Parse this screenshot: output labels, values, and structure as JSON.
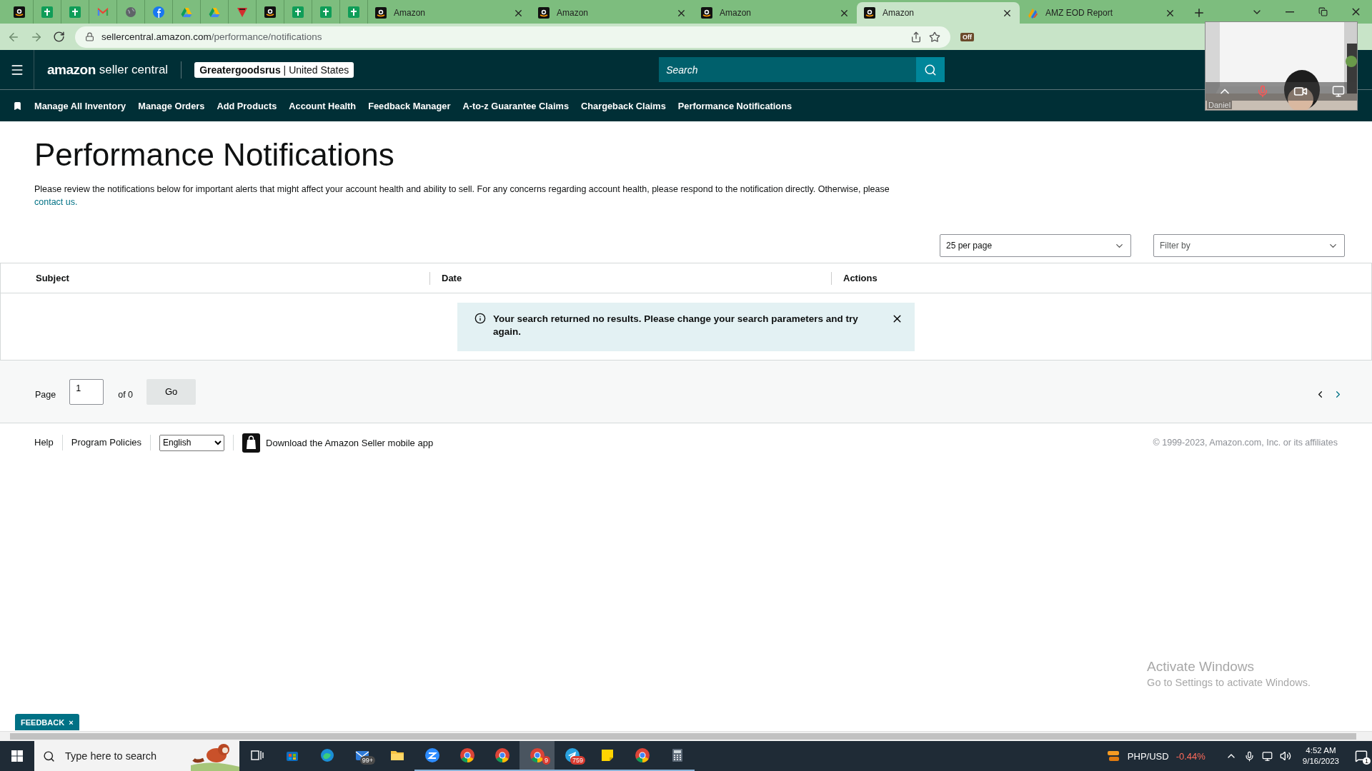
{
  "browser": {
    "tabs": [
      {
        "kind": "amazon",
        "selected": false
      },
      {
        "kind": "sheets",
        "selected": false
      },
      {
        "kind": "sheets",
        "selected": false
      },
      {
        "kind": "gmail",
        "selected": false
      },
      {
        "kind": "globe",
        "selected": false
      },
      {
        "kind": "facebook",
        "selected": false
      },
      {
        "kind": "drive",
        "selected": false
      },
      {
        "kind": "drive",
        "selected": false
      },
      {
        "kind": "triangle",
        "selected": false
      },
      {
        "kind": "amazon",
        "selected": false
      },
      {
        "kind": "sheets",
        "selected": false
      },
      {
        "kind": "sheets",
        "selected": false
      },
      {
        "kind": "sheets",
        "selected": false
      },
      {
        "kind": "amazon",
        "title": "Amazon",
        "selected": false
      },
      {
        "kind": "amazon",
        "title": "Amazon",
        "selected": false
      },
      {
        "kind": "amazon",
        "title": "Amazon",
        "selected": false
      },
      {
        "kind": "amazon",
        "title": "Amazon",
        "selected": true
      },
      {
        "kind": "report",
        "title": "AMZ EOD Report",
        "selected": false
      }
    ],
    "url": {
      "domain": "sellercentral.amazon.com",
      "path": "/performance/notifications"
    },
    "extension_badge": "Off"
  },
  "video_call": {
    "name": "Daniel"
  },
  "header": {
    "logo": {
      "brand": "amazon",
      "product": "seller central"
    },
    "store": {
      "name": "Greatergoodsrus",
      "region": "| United States"
    },
    "search": {
      "placeholder": "Search"
    }
  },
  "nav": {
    "items": [
      "Manage All Inventory",
      "Manage Orders",
      "Add Products",
      "Account Health",
      "Feedback Manager",
      "A-to-z Guarantee Claims",
      "Chargeback Claims",
      "Performance Notifications"
    ]
  },
  "page": {
    "title": "Performance Notifications",
    "description": "Please review the notifications below for important alerts that might affect your account health and ability to sell. For any concerns regarding account health, please respond to the notification directly. Otherwise, please",
    "link": "contact us.",
    "per_page": "25 per page",
    "filter": "Filter by"
  },
  "table": {
    "columns": [
      "Subject",
      "Date",
      "Actions"
    ],
    "alert": "Your search returned no results. Please change your search parameters and try again."
  },
  "pagination": {
    "label": "Page",
    "value": "1",
    "total": "of 0",
    "button": "Go"
  },
  "footer": {
    "links": [
      "Help",
      "Program Policies"
    ],
    "language": "English",
    "app": "Download the Amazon Seller mobile app",
    "copyright": "© 1999-2023, Amazon.com, Inc. or its affiliates"
  },
  "feedback": {
    "label": "FEEDBACK",
    "close": "×"
  },
  "activation": {
    "title": "Activate Windows",
    "subtitle": "Go to Settings to activate Windows."
  },
  "taskbar": {
    "search_placeholder": "Type here to search",
    "apps": [
      {
        "kind": "taskview",
        "running": false,
        "selected": false
      },
      {
        "kind": "store",
        "running": false,
        "selected": false
      },
      {
        "kind": "edge",
        "running": false,
        "selected": false
      },
      {
        "kind": "mail",
        "badge": "99+",
        "running": false,
        "selected": false
      },
      {
        "kind": "folder",
        "running": false,
        "selected": false
      },
      {
        "kind": "zoom",
        "running": true,
        "selected": false
      },
      {
        "kind": "chrome",
        "running": true,
        "selected": false
      },
      {
        "kind": "chrome",
        "running": true,
        "selected": false
      },
      {
        "kind": "chrome",
        "badge": "9",
        "running": true,
        "selected": true
      },
      {
        "kind": "telegram",
        "badge": "759",
        "running": true,
        "selected": false
      },
      {
        "kind": "sticky",
        "running": true,
        "selected": false
      },
      {
        "kind": "chrome",
        "running": true,
        "selected": false
      },
      {
        "kind": "calculator",
        "running": true,
        "selected": false
      }
    ],
    "ticker": {
      "name": "PHP/USD",
      "change": "-0.44%"
    },
    "time": "4:52 AM",
    "date": "9/16/2023",
    "notifications": "1"
  }
}
